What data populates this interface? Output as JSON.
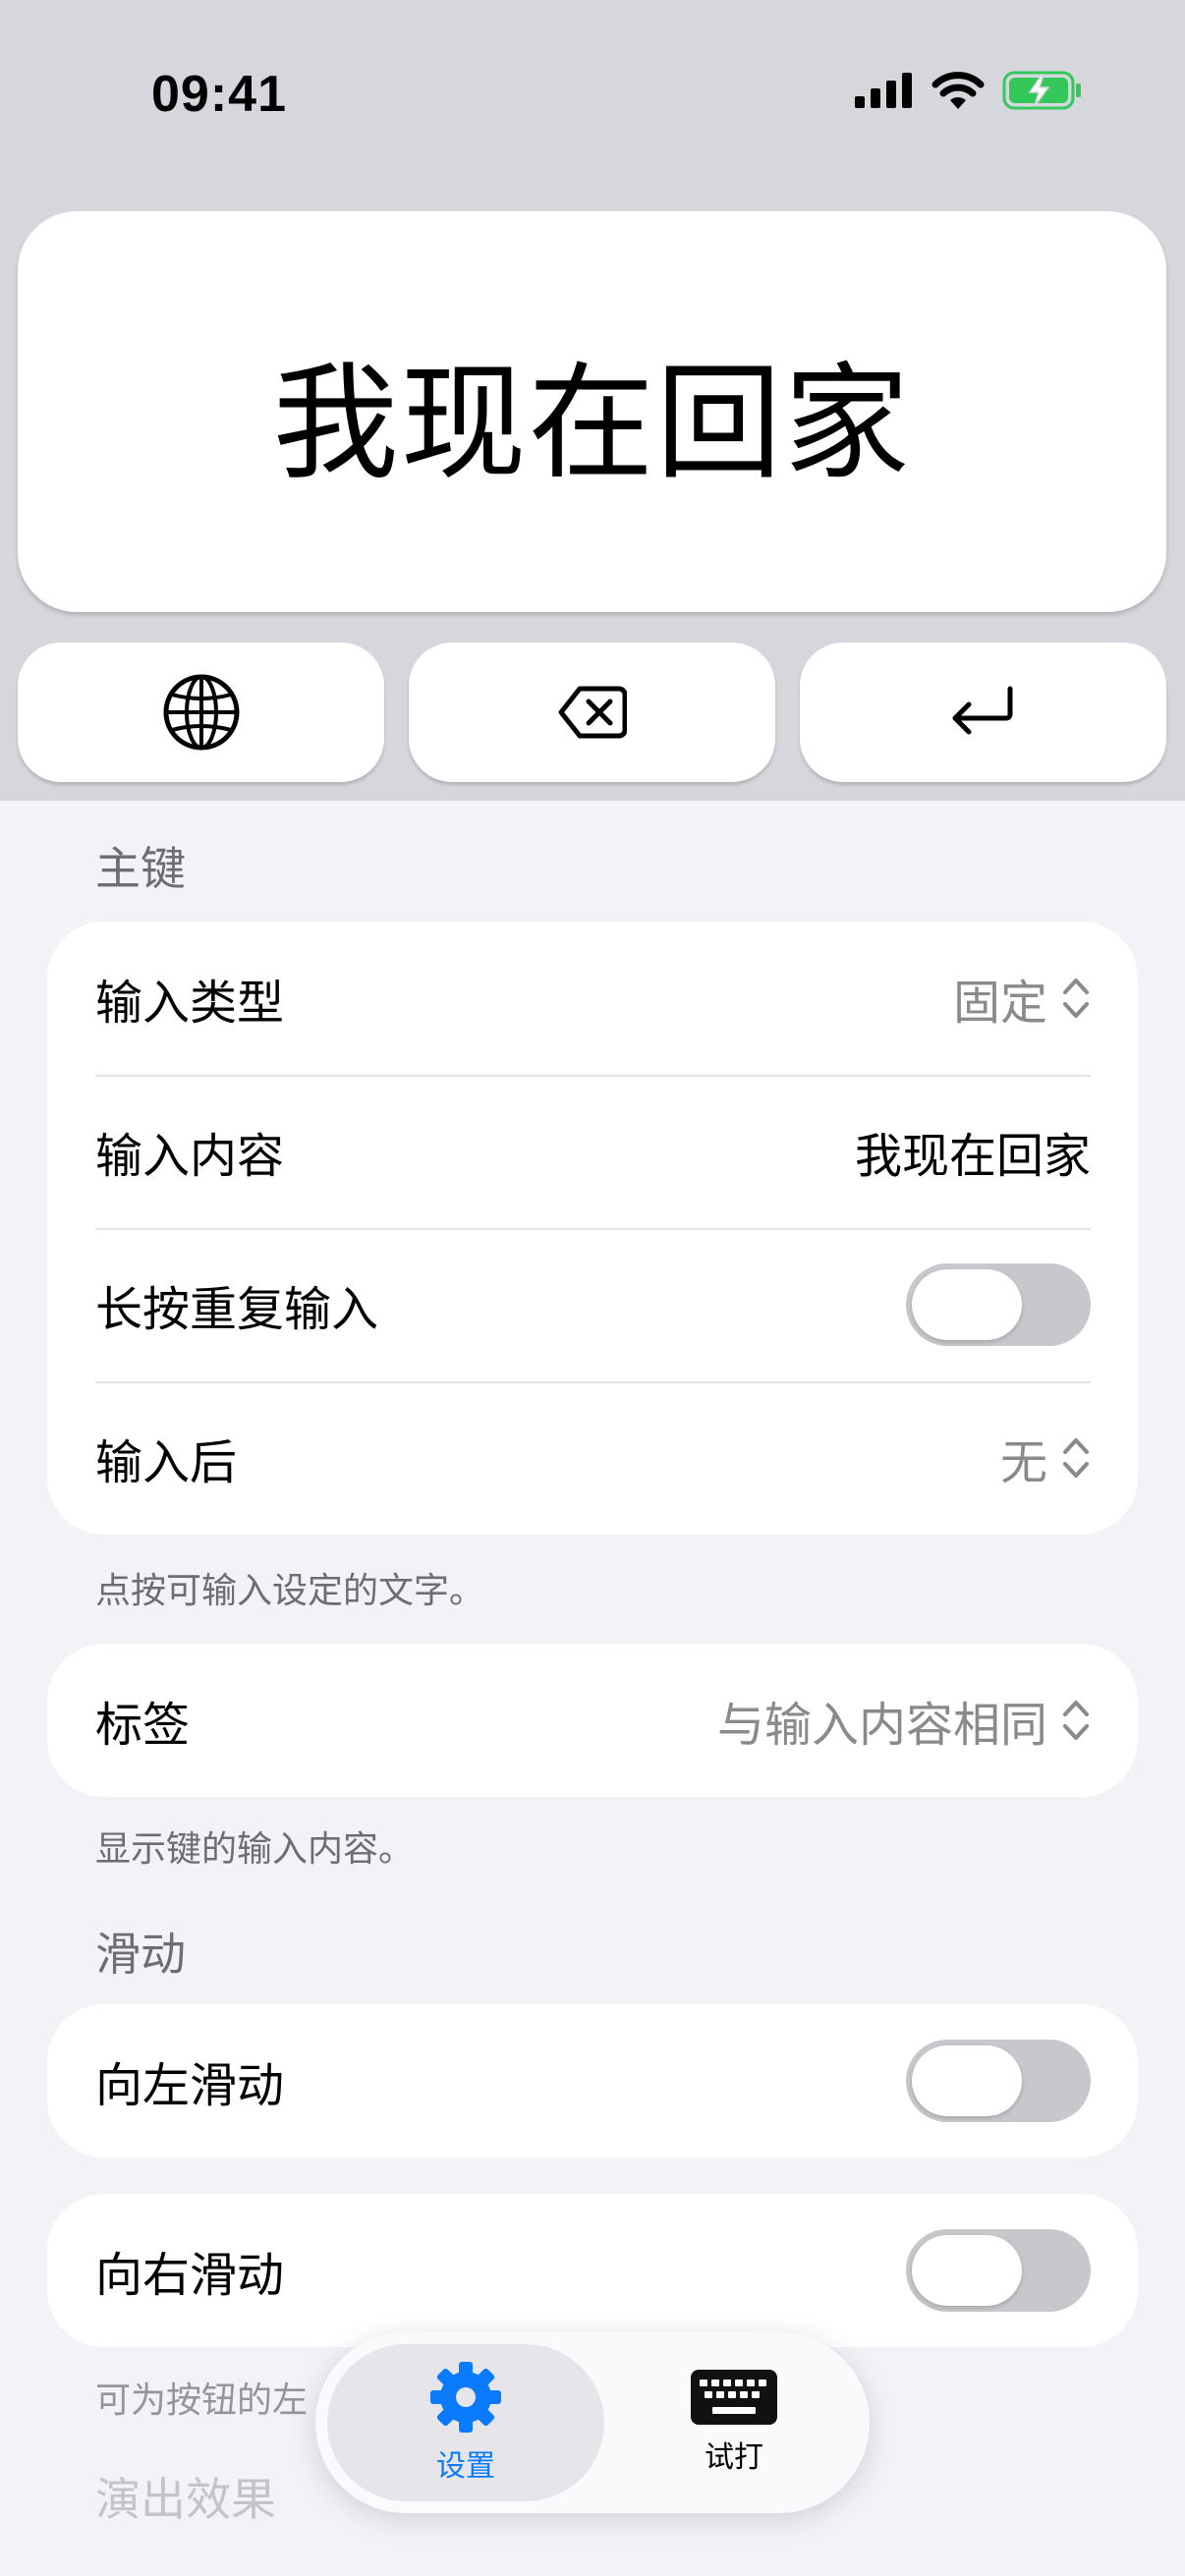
{
  "status_bar": {
    "time": "09:41"
  },
  "preview": {
    "key_text": "我现在回家"
  },
  "function_keys": {
    "globe": "globe-icon",
    "delete": "delete-icon",
    "return": "return-icon"
  },
  "sections": {
    "main_key": {
      "header": "主键",
      "rows": {
        "input_type": {
          "label": "输入类型",
          "value": "固定"
        },
        "input_content": {
          "label": "输入内容",
          "value": "我现在回家"
        },
        "long_press": {
          "label": "长按重复输入",
          "toggle": false
        },
        "after_input": {
          "label": "输入后",
          "value": "无"
        }
      },
      "footer": "点按可输入设定的文字。"
    },
    "label": {
      "row": {
        "label": "标签",
        "value": "与输入内容相同"
      },
      "footer": "显示键的输入内容。"
    },
    "swipe": {
      "header": "滑动",
      "left": {
        "label": "向左滑动",
        "toggle": false
      },
      "right": {
        "label": "向右滑动",
        "toggle": false
      },
      "footer": "可为按钮的左"
    },
    "effects": {
      "header": "演出效果"
    }
  },
  "tabbar": {
    "settings": {
      "label": "设置",
      "color": "#0a7aff"
    },
    "typing": {
      "label": "试打"
    }
  }
}
